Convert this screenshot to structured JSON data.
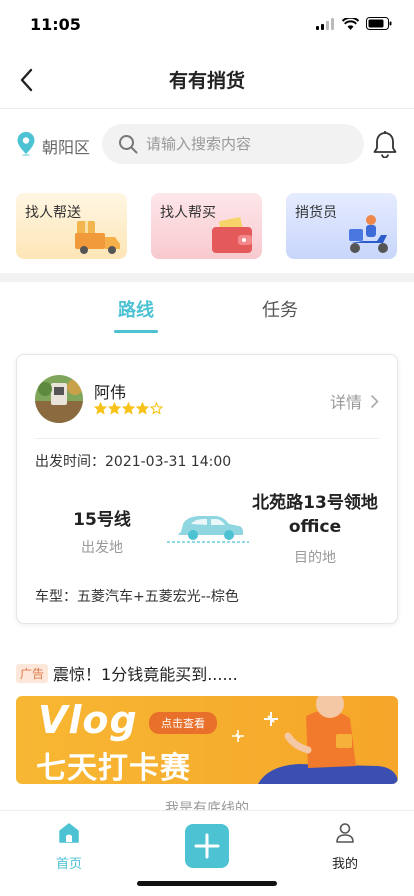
{
  "status": {
    "time": "11:05"
  },
  "nav": {
    "title": "有有捎货"
  },
  "search": {
    "location": "朝阳区",
    "placeholder": "请输入搜索内容"
  },
  "services": [
    {
      "label": "找人帮送"
    },
    {
      "label": "找人帮买"
    },
    {
      "label": "捎货员"
    }
  ],
  "tabs": [
    {
      "label": "路线",
      "active": true
    },
    {
      "label": "任务",
      "active": false
    }
  ],
  "trip": {
    "driver_name": "阿伟",
    "rating": 4,
    "rating_max": 5,
    "detail_label": "详情",
    "depart_time": "出发时间：2021-03-31 14:00",
    "from_name": "15号线",
    "from_label": "出发地",
    "to_name": "北苑路13号领地office",
    "to_label": "目的地",
    "car_type": "车型：五菱汽车+五菱宏光--棕色"
  },
  "ad": {
    "badge": "广告",
    "text": "震惊！1分钱竟能买到......",
    "banner_title": "Vlog",
    "banner_button": "点击查看",
    "banner_headline": "七天打卡赛"
  },
  "feed_cut_text": "我是有底线的",
  "tabbar": {
    "home": "首页",
    "mine": "我的"
  },
  "colors": {
    "accent": "#4cc2d3",
    "star": "#f7c31a"
  }
}
